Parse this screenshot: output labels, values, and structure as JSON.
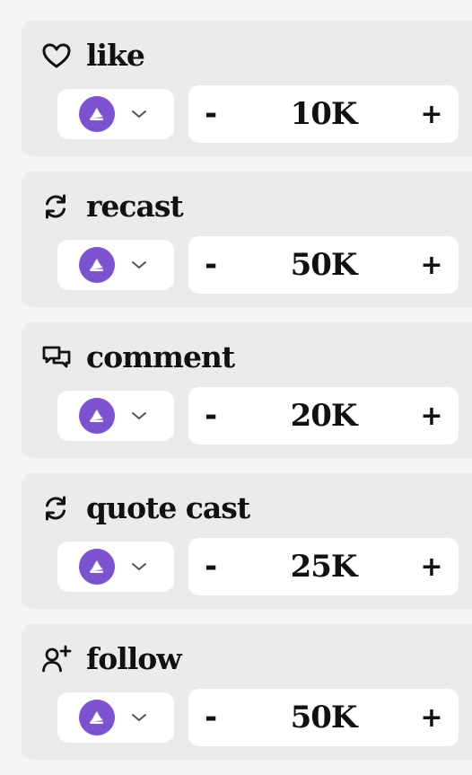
{
  "actions": [
    {
      "key": "like",
      "label": "like",
      "icon": "heart-icon",
      "value": "10K"
    },
    {
      "key": "recast",
      "label": "recast",
      "icon": "recast-icon",
      "value": "50K"
    },
    {
      "key": "comment",
      "label": "comment",
      "icon": "comment-icon",
      "value": "20K"
    },
    {
      "key": "quote-cast",
      "label": "quote cast",
      "icon": "recast-icon",
      "value": "25K"
    },
    {
      "key": "follow",
      "label": "follow",
      "icon": "user-plus-icon",
      "value": "50K"
    }
  ],
  "stepper": {
    "minus_label": "-",
    "plus_label": "+"
  },
  "colors": {
    "page_bg": "#f5f5f5",
    "card_bg": "#ebebeb",
    "token_accent": "#7c52cf"
  }
}
